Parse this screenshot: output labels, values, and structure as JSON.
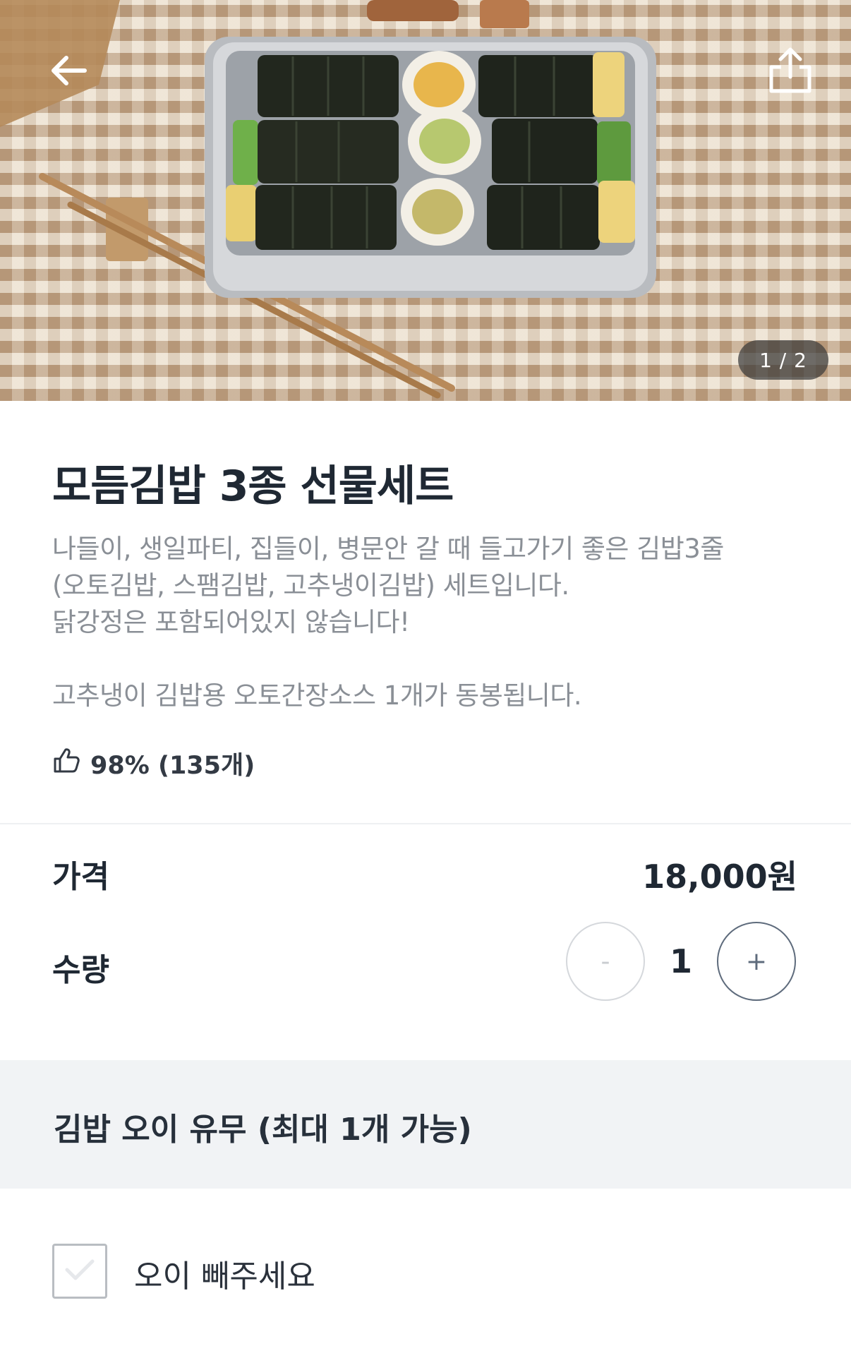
{
  "header": {
    "back_icon": "arrow-left-icon",
    "share_icon": "share-icon",
    "image_counter": "1 / 2"
  },
  "product": {
    "title": "모듬김밥 3종 선물세트",
    "description": "나들이, 생일파티, 집들이, 병문안 갈 때 들고가기 좋은 김밥3줄\n(오토김밥, 스팸김밥, 고추냉이김밥) 세트입니다.\n닭강정은 포함되어있지 않습니다!\n\n고추냉이 김밥용 오토간장소스 1개가 동봉됩니다.",
    "rating_icon": "thumbs-up-icon",
    "rating": "98% (135개)"
  },
  "price": {
    "label": "가격",
    "value": "18,000원"
  },
  "quantity": {
    "label": "수량",
    "minus": "-",
    "value": "1",
    "plus": "+"
  },
  "options": {
    "group_title": "김밥 오이 유무 (최대 1개 가능)",
    "items": [
      {
        "label": "오이 빼주세요",
        "checked": false
      }
    ]
  }
}
